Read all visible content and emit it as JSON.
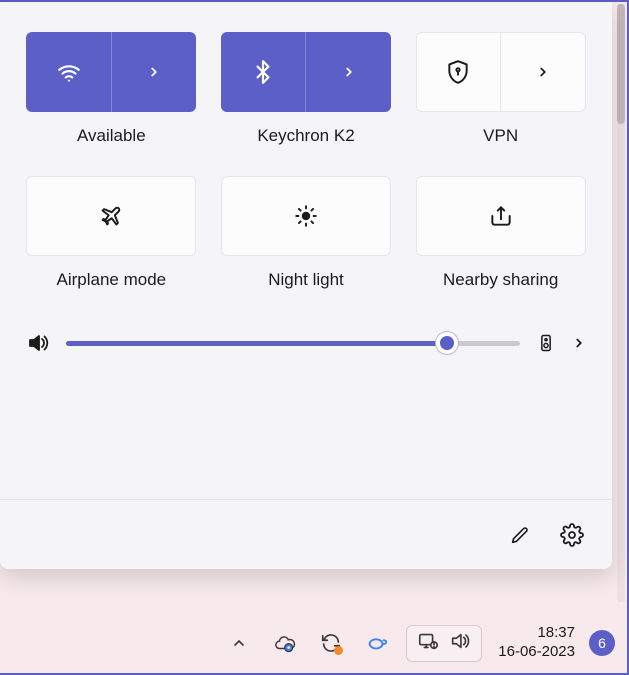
{
  "accent": "#5b5fc7",
  "tiles": {
    "wifi": {
      "label": "Available",
      "active": true
    },
    "bluetooth": {
      "label": "Keychron K2",
      "active": true
    },
    "vpn": {
      "label": "VPN",
      "active": false
    },
    "airplane": {
      "label": "Airplane mode",
      "active": false
    },
    "nightlight": {
      "label": "Night light",
      "active": false
    },
    "nearby": {
      "label": "Nearby sharing",
      "active": false
    }
  },
  "volume": {
    "percent": 84
  },
  "taskbar": {
    "time": "18:37",
    "date": "16-06-2023",
    "notification_count": "6"
  }
}
